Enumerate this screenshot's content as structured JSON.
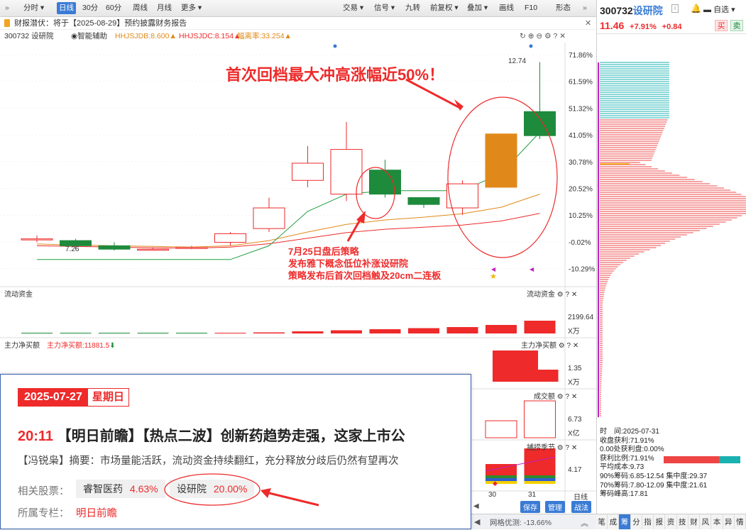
{
  "toolbar": {
    "items": [
      "分时",
      "日线",
      "30分",
      "60分",
      "周线",
      "月线",
      "更多"
    ],
    "right_items": [
      "交易",
      "信号",
      "九转",
      "前复权",
      "叠加",
      "画线",
      "F10",
      "形态"
    ]
  },
  "stock": {
    "code": "300732",
    "name": "设研院",
    "price": "11.46",
    "change_pct": "+7.91%",
    "change": "+0.84",
    "buy": "买",
    "sell": "卖",
    "watch": "自选"
  },
  "notice": {
    "text": "财报潜伏：将于【2025-08-29】预约披露财务报告"
  },
  "indicators": {
    "code_name": "300732 设研院",
    "assist": "智能辅助",
    "hhjsjdb": "HHJSJDB:8.600",
    "hhjsjdc": "HHJSJDC:8.154",
    "lowpoint": "幅离率:33.254"
  },
  "price_axis": [
    "71.86%",
    "61.59%",
    "51.32%",
    "41.05%",
    "30.78%",
    "20.52%",
    "10.25%",
    "-0.02%",
    "-10.29%"
  ],
  "annotations": {
    "headline": "首次回档最大冲高涨幅近50%！",
    "note1": "7月25日盘后策略",
    "note2": "发布雅下概念低位补涨设研院",
    "note3": "策略发布后首次回档触及20cm二连板",
    "high_label": "12.74",
    "low_label": "7.26"
  },
  "chart_data": {
    "type": "candlestick",
    "candles": [
      {
        "o": 7.6,
        "c": 7.6,
        "h": 7.7,
        "l": 7.5
      },
      {
        "o": 7.55,
        "c": 7.4,
        "h": 7.6,
        "l": 7.3
      },
      {
        "o": 7.4,
        "c": 7.3,
        "h": 7.5,
        "l": 7.26
      },
      {
        "o": 7.3,
        "c": 7.3,
        "h": 7.35,
        "l": 7.26
      },
      {
        "o": 7.35,
        "c": 7.35,
        "h": 7.4,
        "l": 7.3
      },
      {
        "o": 7.5,
        "c": 7.75,
        "h": 7.8,
        "l": 7.4
      },
      {
        "o": 7.9,
        "c": 8.5,
        "h": 8.8,
        "l": 7.8
      },
      {
        "o": 9.3,
        "c": 9.8,
        "h": 10.3,
        "l": 9.1
      },
      {
        "o": 8.9,
        "c": 10.2,
        "h": 11.0,
        "l": 8.7
      },
      {
        "o": 9.6,
        "c": 8.9,
        "h": 9.9,
        "l": 8.8
      },
      {
        "o": 8.8,
        "c": 8.6,
        "h": 8.8,
        "l": 8.5
      },
      {
        "o": 8.5,
        "c": 9.2,
        "h": 9.3,
        "l": 8.3
      },
      {
        "o": 9.1,
        "c": 10.65,
        "h": 10.65,
        "l": 9.1
      },
      {
        "o": 11.3,
        "c": 10.6,
        "h": 12.74,
        "l": 10.5
      }
    ],
    "ma_green": [
      7.0,
      7.0,
      7.0,
      7.0,
      7.0,
      7.0,
      7.4,
      8.4,
      8.9,
      9.0,
      9.0,
      9.0,
      9.5,
      10.7
    ],
    "ma_orange": [
      7.45,
      7.42,
      7.4,
      7.38,
      7.36,
      7.4,
      7.55,
      7.8,
      8.02,
      8.15,
      8.23,
      8.33,
      8.52,
      8.9
    ],
    "ma_red": [
      7.4,
      7.38,
      7.36,
      7.34,
      7.33,
      7.36,
      7.46,
      7.62,
      7.78,
      7.88,
      7.94,
      8.0,
      8.12,
      8.34
    ]
  },
  "liudong": {
    "label": "流动资金",
    "value": "2199.64",
    "unit": "X万"
  },
  "liudong_bars": [
    0,
    0,
    0,
    0,
    0,
    0,
    1,
    2,
    3,
    4,
    5,
    6,
    8,
    12
  ],
  "zhuli": {
    "label": "主力净买额",
    "value_label": "主力净买额:11881.5",
    "axis": "1.35",
    "unit": "X万"
  },
  "volume": {
    "label": "成交额",
    "axis": "6.73",
    "unit": "X亿"
  },
  "season": {
    "label": "捕捞季节",
    "axis": "4.17"
  },
  "x_dates": [
    "30",
    "31"
  ],
  "day_btn": "日线",
  "right_stats": {
    "time": "时　间:2025-07-31",
    "profit": "收盘获利:71.91%",
    "zero": "0.00处获利盘:0.00%",
    "ratio": "获利比例:71.91%",
    "avg": "平均成本:9.73",
    "c90": "90%筹码:6.85-12.54",
    "d90": "集中度:29.37",
    "c70": "70%筹码:7.80-12.09",
    "d70": "集中度:21.61",
    "hhsm": "筹码峰高:17.81"
  },
  "right_tabs": [
    "笔",
    "成",
    "筹",
    "分",
    "指",
    "报",
    "资",
    "技",
    "财",
    "风",
    "本",
    "异",
    "情"
  ],
  "popup": {
    "date": "2025-07-27",
    "weekday": "星期日",
    "time": "20:11",
    "title": "【明日前瞻】【热点二波】创新药趋势走强，这家上市公",
    "summary": "【冯锐枭】摘要：市场量能活跃，流动资金持续翻红，充分释放分歧后仍然有望再次",
    "related_label": "相关股票：",
    "stock1_name": "睿智医药",
    "stock1_pct": "4.63%",
    "stock2_name": "设研院",
    "stock2_pct": "20.00%",
    "column_label": "所属专栏：",
    "column_name": "明日前瞻"
  },
  "bottom": {
    "save": "保存",
    "manage": "管理",
    "compare": "战法",
    "grid": "网格优测:",
    "grid_val": "-13.66%"
  },
  "colors": {
    "up": "#ee2a2a",
    "down": "#1e8a3c",
    "orange": "#e0891a",
    "blue": "#3a7bd5"
  }
}
